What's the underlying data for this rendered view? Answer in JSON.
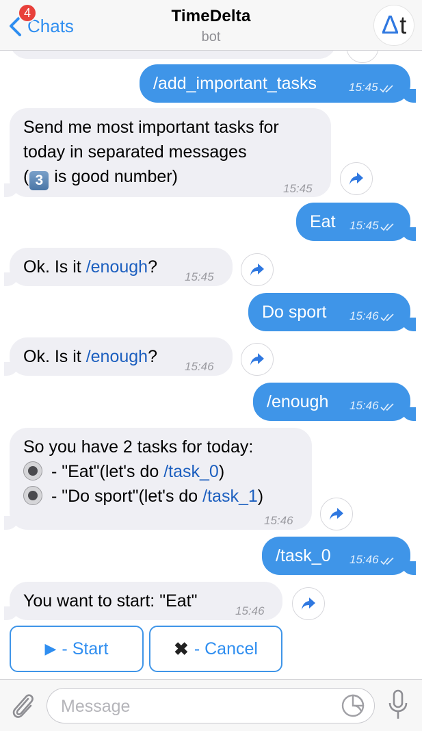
{
  "header": {
    "back_label": "Chats",
    "unread_count": "4",
    "title": "TimeDelta",
    "subtitle": "bot",
    "avatar": {
      "delta": "Δ",
      "t": "t"
    }
  },
  "messages": [
    {
      "text": "/add_important_tasks",
      "time": "15:45"
    },
    {
      "line1": "Send me most important tasks for",
      "line2": "today in separated messages",
      "line3_open": "(",
      "line3_key": "3",
      "line3_rest": " is good number)",
      "time": "15:45"
    },
    {
      "text": "Eat",
      "time": "15:45"
    },
    {
      "prefix": "Ok. Is it ",
      "command": "/enough",
      "suffix": "?",
      "time": "15:45"
    },
    {
      "text": "Do sport",
      "time": "15:46"
    },
    {
      "prefix": "Ok. Is it ",
      "command": "/enough",
      "suffix": "?",
      "time": "15:46"
    },
    {
      "text": "/enough",
      "time": "15:46"
    },
    {
      "line1": "So you have 2 tasks for today:",
      "item1_text": " - \"Eat\"(let's do ",
      "item1_cmd": "/task_0",
      "item1_close": ")",
      "item2_text": " - \"Do sport\"(let's do ",
      "item2_cmd": "/task_1",
      "item2_close": ")",
      "time": "15:46"
    },
    {
      "text": "/task_0",
      "time": "15:46"
    },
    {
      "text": "You want to start: \"Eat\"",
      "time": "15:46"
    }
  ],
  "keyboard": {
    "start_glyph": "▶",
    "start_label": " - Start",
    "cancel_glyph": "✖",
    "cancel_label": " - Cancel"
  },
  "input": {
    "placeholder": "Message"
  },
  "icons": [
    "chevron-left-icon",
    "paperclip-icon",
    "sticker-icon",
    "microphone-icon",
    "share-icon",
    "double-check-icon"
  ],
  "colors": {
    "accent": "#2f8ef0",
    "outgoing_bubble": "#3f95e8",
    "incoming_bubble": "#efeff4",
    "badge": "#e8403a",
    "command_link": "#1c5fbf"
  }
}
